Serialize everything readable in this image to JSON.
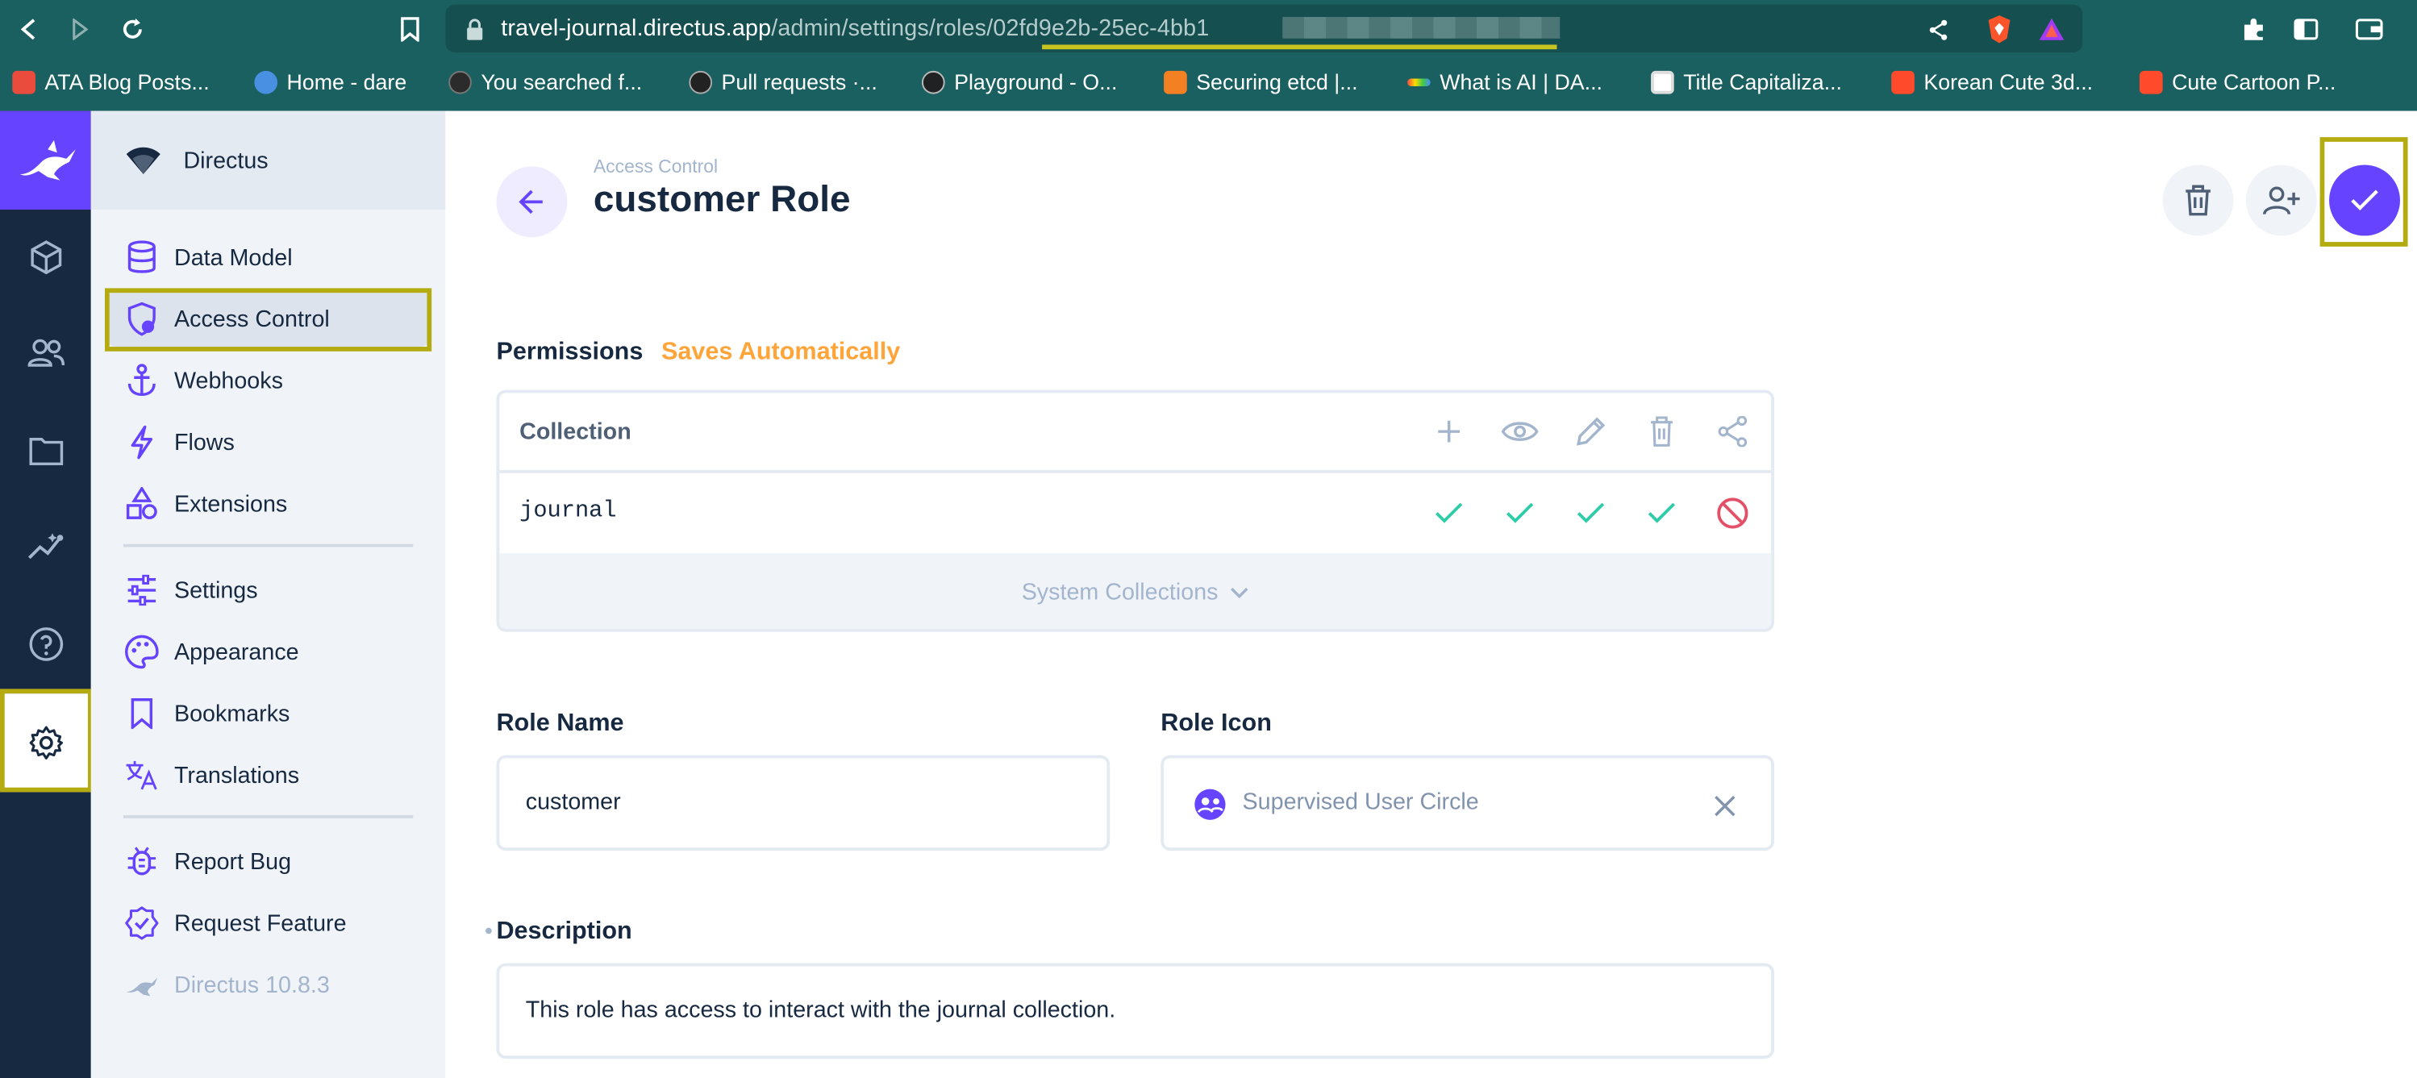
{
  "browser": {
    "url_host": "travel-journal.directus.app",
    "url_path": "/admin/settings/roles/",
    "url_id": "02fd9e2b-25ec-4bb1",
    "bookmarks": [
      {
        "label": "ATA Blog Posts...",
        "color": "#e94b3c"
      },
      {
        "label": "Home - dare",
        "color": "#4a90e2"
      },
      {
        "label": "You searched f...",
        "color": "#2b2b2b"
      },
      {
        "label": "Pull requests ·...",
        "color": "#222222"
      },
      {
        "label": "Playground - O...",
        "color": "#202123"
      },
      {
        "label": "Securing etcd |...",
        "color": "#f48024"
      },
      {
        "label": "What is AI | DA...",
        "color": "#9b59b6"
      },
      {
        "label": "Title Capitaliza...",
        "color": "#ffffff"
      },
      {
        "label": "Korean Cute 3d...",
        "color": "#ff4b2b"
      },
      {
        "label": "Cute Cartoon P...",
        "color": "#ff4b2b"
      }
    ]
  },
  "app": {
    "project_name": "Directus",
    "accent": "#6644ff",
    "nav": {
      "items": [
        {
          "label": "Data Model",
          "icon": "database-icon"
        },
        {
          "label": "Access Control",
          "icon": "admin-shield-icon"
        },
        {
          "label": "Webhooks",
          "icon": "anchor-icon"
        },
        {
          "label": "Flows",
          "icon": "bolt-icon"
        },
        {
          "label": "Extensions",
          "icon": "category-icon"
        },
        {
          "label": "Settings",
          "icon": "tune-icon"
        },
        {
          "label": "Appearance",
          "icon": "palette-icon"
        },
        {
          "label": "Bookmarks",
          "icon": "bookmark-icon"
        },
        {
          "label": "Translations",
          "icon": "translate-icon"
        },
        {
          "label": "Report Bug",
          "icon": "bug-icon"
        },
        {
          "label": "Request Feature",
          "icon": "new-releases-icon"
        }
      ],
      "version": "Directus 10.8.3"
    }
  },
  "page": {
    "breadcrumb": "Access Control",
    "title": "customer Role",
    "permissions": {
      "label": "Permissions",
      "saves_note": "Saves Automatically",
      "column_header": "Collection",
      "rows": [
        {
          "collection": "journal",
          "create": "all",
          "read": "all",
          "update": "all",
          "delete": "all",
          "share": "none"
        }
      ],
      "system_collections": "System Collections"
    },
    "fields": {
      "role_name_label": "Role Name",
      "role_name_value": "customer",
      "role_icon_label": "Role Icon",
      "role_icon_value": "Supervised User Circle",
      "description_label": "Description",
      "description_value": "This role has access to interact with the journal collection."
    }
  }
}
